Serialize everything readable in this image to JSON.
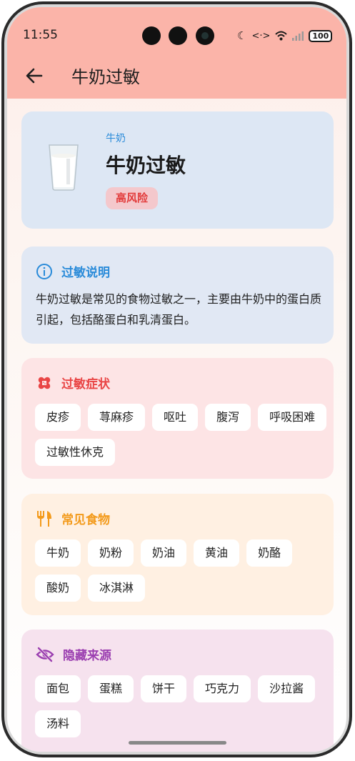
{
  "status_bar": {
    "time": "11:55",
    "battery": "100"
  },
  "app_bar": {
    "title": "牛奶过敏"
  },
  "hero": {
    "category": "牛奶",
    "title": "牛奶过敏",
    "risk_label": "高风险"
  },
  "description": {
    "title": "过敏说明",
    "text": "牛奶过敏是常见的食物过敏之一，主要由牛奶中的蛋白质引起，包括酪蛋白和乳清蛋白。"
  },
  "symptoms": {
    "title": "过敏症状",
    "items": [
      "皮疹",
      "荨麻疹",
      "呕吐",
      "腹泻",
      "呼吸困难",
      "过敏性休克"
    ]
  },
  "common_foods": {
    "title": "常见食物",
    "items": [
      "牛奶",
      "奶粉",
      "奶油",
      "黄油",
      "奶酪",
      "酸奶",
      "冰淇淋"
    ]
  },
  "hidden_sources": {
    "title": "隐藏来源",
    "items": [
      "面包",
      "蛋糕",
      "饼干",
      "巧克力",
      "沙拉酱",
      "汤料"
    ]
  },
  "colors": {
    "app_bar": "#fbb4a9",
    "info_accent": "#2a8bd9",
    "symptom_accent": "#e94545",
    "food_accent": "#f39a1b",
    "hidden_accent": "#9b3fb0"
  }
}
